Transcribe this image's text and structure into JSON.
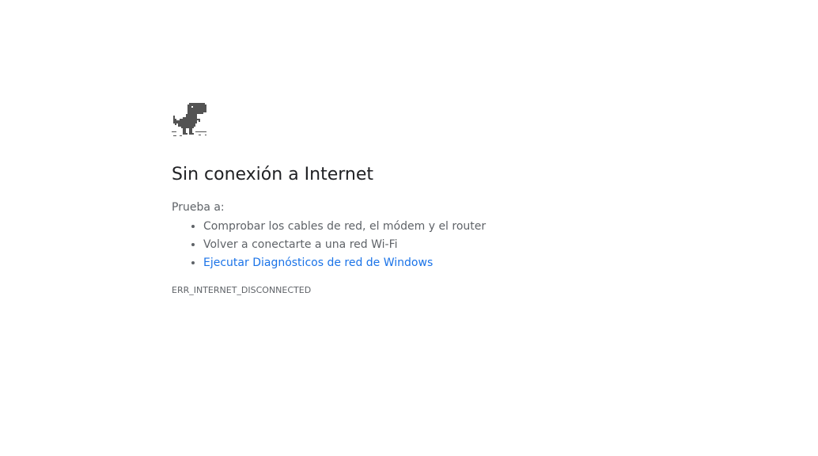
{
  "icons": {
    "offline": "dinosaur-icon"
  },
  "error": {
    "title": "Sin conexión a Internet",
    "suggest_intro": "Prueba a:",
    "suggestions": [
      "Comprobar los cables de red, el módem y el router",
      "Volver a conectarte a una red Wi-Fi"
    ],
    "link_label": "Ejecutar Diagnósticos de red de Windows",
    "code": "ERR_INTERNET_DISCONNECTED"
  },
  "colors": {
    "title": "#202124",
    "text": "#5f6368",
    "link": "#1a73e8",
    "dino": "#535353"
  }
}
